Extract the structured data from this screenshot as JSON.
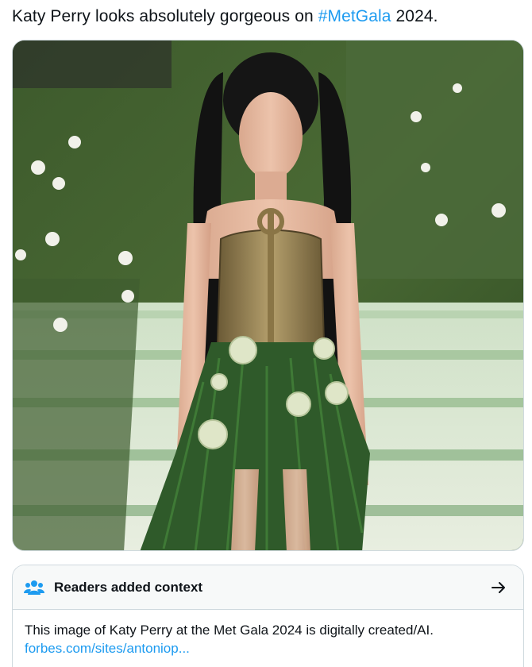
{
  "tweet": {
    "text_before": "Katy Perry looks absolutely gorgeous on ",
    "hashtag": "#MetGala",
    "text_after": " 2024."
  },
  "media": {
    "description_icon": "photo"
  },
  "community_note": {
    "icon": "people-icon",
    "title": "Readers added context",
    "arrow_icon": "arrow-right-icon",
    "body": "This image of Katy Perry at the Met Gala 2024 is digitally created/AI.",
    "link": "forbes.com/sites/antoniop..."
  },
  "colors": {
    "link_blue": "#1d9bf0",
    "text": "#0f1419",
    "border": "#cfd9de",
    "note_header_bg": "#f7f9f9"
  }
}
